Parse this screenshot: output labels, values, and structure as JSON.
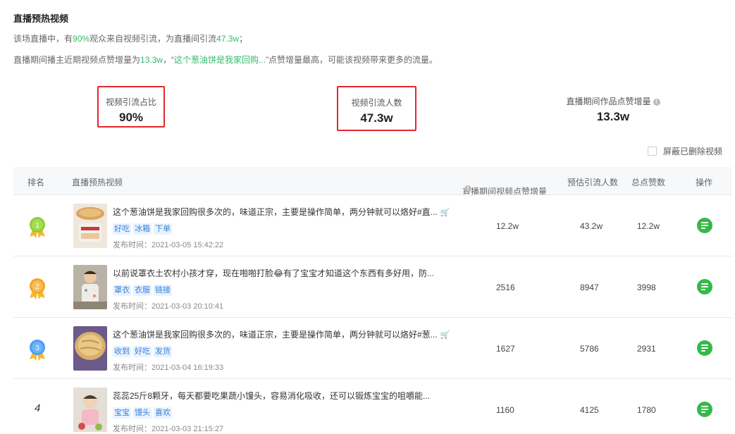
{
  "section_title": "直播预热视频",
  "summary": {
    "line1": {
      "prefix": "该场直播中，有",
      "percent": "90%",
      "mid": "观众来自视频引流，为直播间引流",
      "count": "47.3w",
      "suffix": "；"
    },
    "line2": {
      "prefix": "直播期间播主近期视频点赞增量为",
      "likes": "13.3w",
      "sep": "，“",
      "video": "这个葱油饼是我家回购...",
      "suffix": "”点赞增量最高，可能该视频带来更多的流量。"
    }
  },
  "stats": [
    {
      "label": "视频引流占比",
      "value": "90%"
    },
    {
      "label": "视频引流人数",
      "value": "47.3w"
    },
    {
      "label": "直播期间作品点赞增量",
      "value": "13.3w"
    }
  ],
  "hide_deleted_label": "屏蔽已删除视频",
  "columns": {
    "rank": "排名",
    "video": "直播预热视频",
    "likes": "直播期间视频点赞增量",
    "traffic": "预估引流人数",
    "total": "总点赞数",
    "action": "操作"
  },
  "rows": [
    {
      "rank": "1",
      "medal": "gold",
      "title": "这个葱油饼是我家回购很多次的，味道正宗，主要是操作简单，两分钟就可以烙好#直...",
      "has_cart": true,
      "tags": [
        "好吃",
        "冰箱",
        "下单"
      ],
      "publish": "发布时间：2021-03-05 15:42:22",
      "likes": "12.2w",
      "traffic": "43.2w",
      "total": "12.2w"
    },
    {
      "rank": "2",
      "medal": "orange",
      "title": "以前说罩衣土农村小孩才穿，现在啪啪打脸😂有了宝宝才知道这个东西有多好用，防...",
      "has_cart": false,
      "tags": [
        "罩衣",
        "衣服",
        "链接"
      ],
      "publish": "发布时间：2021-03-03 20:10:41",
      "likes": "2516",
      "traffic": "8947",
      "total": "3998"
    },
    {
      "rank": "3",
      "medal": "blue",
      "title": "这个葱油饼是我家回购很多次的，味道正宗，主要是操作简单，两分钟就可以烙好#葱...",
      "has_cart": true,
      "tags": [
        "收到",
        "好吃",
        "发货"
      ],
      "publish": "发布时间：2021-03-04 16:19:33",
      "likes": "1627",
      "traffic": "5786",
      "total": "2931"
    },
    {
      "rank": "4",
      "medal": "",
      "title": "蕊蕊25斤8颗牙，每天都要吃果蔬小馒头，容易消化吸收，还可以锻炼宝宝的咀嚼能...",
      "has_cart": false,
      "tags": [
        "宝宝",
        "馒头",
        "喜欢"
      ],
      "publish": "发布时间：2021-03-03 21:15:27",
      "likes": "1160",
      "traffic": "4125",
      "total": "1780"
    }
  ],
  "colors": {
    "highlight": "#35b96b",
    "red_box": "#e3262e",
    "tag_bg": "#e8f3ff",
    "tag_text": "#3a80d9",
    "action_btn": "#35b94a",
    "medal_gold": "#8ccf3a",
    "medal_orange": "#f5a623",
    "medal_blue": "#4a9ef5"
  }
}
